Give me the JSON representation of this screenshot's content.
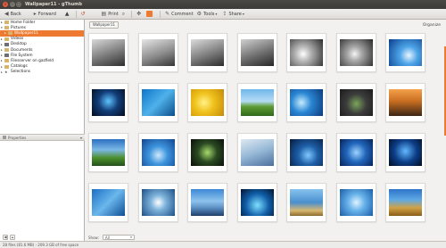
{
  "window": {
    "title": "Wallpaper11 - gThumb"
  },
  "toolbar": {
    "back_label": "Back",
    "forward_label": "Forward",
    "print_label": "Print",
    "comment_label": "Comment",
    "tools_label": "Tools",
    "share_label": "Share"
  },
  "sidebar": {
    "items": [
      {
        "label": "Home Folder",
        "arrow": "▸",
        "icon": "folder"
      },
      {
        "label": "Pictures",
        "arrow": "▾",
        "icon": "folder"
      },
      {
        "label": "Wallpaper11",
        "arrow": "▸",
        "icon": "folder",
        "selected": true,
        "sub": true
      },
      {
        "label": "Videos",
        "arrow": "▸",
        "icon": "folder"
      },
      {
        "label": "Desktop",
        "arrow": "▸",
        "icon": "folder-dark"
      },
      {
        "label": "Documents",
        "arrow": "▸",
        "icon": "folder"
      },
      {
        "label": "File System",
        "arrow": "▸",
        "icon": "folder-dark"
      },
      {
        "label": "Filesserver on gazfield",
        "arrow": "▸",
        "icon": "folder"
      },
      {
        "label": "Catalogs",
        "arrow": "▸",
        "icon": "folder"
      },
      {
        "label": "Selections",
        "arrow": "▸",
        "icon": "star"
      }
    ]
  },
  "properties": {
    "label": "Properties"
  },
  "path": {
    "crumb": "Wallpaper11",
    "organize_label": "Organize"
  },
  "show": {
    "label": "Show:",
    "value": "All"
  },
  "status": {
    "text": "28 files (81.6 MB) - 209.3 GB of free space"
  },
  "thumbnails": [
    {
      "bg": "linear-gradient(160deg,#d9d9d9 0%,#7a7a7a 55%,#2e2e2e 100%)"
    },
    {
      "bg": "linear-gradient(160deg,#e6e6e6 0%,#8d8d8d 55%,#363636 100%)"
    },
    {
      "bg": "linear-gradient(160deg,#dcdcdc 0%,#7d7d7d 55%,#2c2c2c 100%)"
    },
    {
      "bg": "linear-gradient(160deg,#d0d0d0 0%,#6f6f6f 55%,#262626 100%)"
    },
    {
      "bg": "radial-gradient(circle at 40% 55%,#ffffff 0%,#b7b7b7 30%,#2a2a2a 100%)"
    },
    {
      "bg": "radial-gradient(circle at 45% 55%,#f5f5f5 0%,#a8a8a8 30%,#262626 100%)"
    },
    {
      "bg": "radial-gradient(circle at 60% 60%,#e9f5ff 0%,#4ca4e7 35%,#0b3d8d 100%)"
    },
    {
      "bg": "radial-gradient(circle at 50% 45%,#5ec2ff 0%,#123e78 45%,#020b1d 100%)"
    },
    {
      "bg": "linear-gradient(135deg,#0e76c9 0%,#4fb1ea 50%,#0c4d8a 100%)"
    },
    {
      "bg": "radial-gradient(circle at 40% 50%,#fff28a 0%,#f0c21d 40%,#c58b06 100%)"
    },
    {
      "bg": "linear-gradient(180deg,#6fb6ea 0%,#b5dcf4 45%,#5e9b34 65%,#2f6a1a 100%)"
    },
    {
      "bg": "radial-gradient(circle at 35% 50%,#c6ecff 0%,#2a86d4 40%,#0d3b7a 100%)"
    },
    {
      "bg": "radial-gradient(circle at 50% 55%,#7aa55a 0%,#3c3c3c 45%,#1b1b1b 100%)"
    },
    {
      "bg": "linear-gradient(180deg,#f4a24a 0%,#c86d21 45%,#3b2614 100%)"
    },
    {
      "bg": "linear-gradient(180deg,#2b6fc0 0%,#7bb8e6 40%,#4c8e2c 70%,#23501a 100%)"
    },
    {
      "bg": "radial-gradient(circle at 50% 60%,#cde8fb 0%,#3d94dd 40%,#10468f 100%)"
    },
    {
      "bg": "radial-gradient(circle at 50% 50%,#a8d96b 0%,#2a4a22 45%,#0a0f0a 100%)"
    },
    {
      "bg": "linear-gradient(160deg,#dfe8f2 0%,#95b8d6 50%,#4a6f9e 100%)"
    },
    {
      "bg": "radial-gradient(circle at 55% 60%,#7fc8ff 0%,#1e5fa8 40%,#051a3d 100%)"
    },
    {
      "bg": "radial-gradient(circle at 50% 50%,#9bd3ff 0%,#2166bb 45%,#062258 100%)"
    },
    {
      "bg": "radial-gradient(circle at 50% 45%,#60b8ff 0%,#0d3f88 50%,#020c22 100%)"
    },
    {
      "bg": "linear-gradient(135deg,#1a6fc4 0%,#6ab7ec 50%,#0f4e94 100%)"
    },
    {
      "bg": "radial-gradient(circle at 50% 50%,#ffffff 0%,#7fb4dc 35%,#1c4f86 100%)"
    },
    {
      "bg": "linear-gradient(180deg,#3c88d6 0%,#8ec3ec 45%,#5a8ec2 70%,#1f3f6a 100%)"
    },
    {
      "bg": "radial-gradient(circle at 50% 60%,#7ee0ff 0%,#105ea8 50%,#02142e 100%)"
    },
    {
      "bg": "linear-gradient(180deg,#86c2ee 0%,#4a8fce 50%,#d9b870 80%,#8a6a2c 100%)"
    },
    {
      "bg": "radial-gradient(circle at 50% 50%,#dff3ff 0%,#67b2ea 40%,#1a5ea8 100%)"
    },
    {
      "bg": "linear-gradient(180deg,#2d74c9 0%,#5ea9e5 40%,#d0a244 70%,#8a5c1a 100%)"
    }
  ]
}
